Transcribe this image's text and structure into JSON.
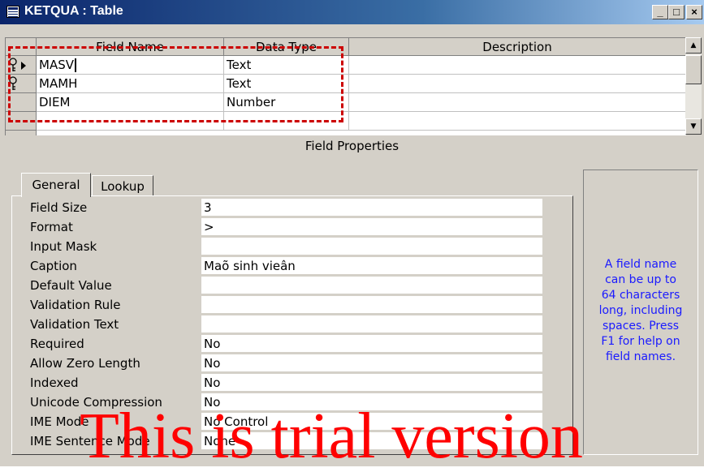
{
  "window": {
    "title": "KETQUA : Table",
    "buttons": {
      "minimize": "_",
      "maximize": "□",
      "close": "×"
    }
  },
  "grid": {
    "headers": [
      "Field Name",
      "Data Type",
      "Description"
    ],
    "rows": [
      {
        "field_name": "MASV",
        "data_type": "Text",
        "description": "",
        "key": true,
        "current": true
      },
      {
        "field_name": "MAMH",
        "data_type": "Text",
        "description": "",
        "key": true,
        "current": false
      },
      {
        "field_name": "DIEM",
        "data_type": "Number",
        "description": "",
        "key": false,
        "current": false
      },
      {
        "field_name": "",
        "data_type": "",
        "description": "",
        "key": false,
        "current": false
      }
    ]
  },
  "field_properties": {
    "title": "Field Properties",
    "tabs": [
      "General",
      "Lookup"
    ],
    "active_tab": "General",
    "properties": [
      {
        "label": "Field Size",
        "value": "3"
      },
      {
        "label": "Format",
        "value": ">"
      },
      {
        "label": "Input Mask",
        "value": ""
      },
      {
        "label": "Caption",
        "value": "Maõ sinh vieân"
      },
      {
        "label": "Default Value",
        "value": ""
      },
      {
        "label": "Validation Rule",
        "value": ""
      },
      {
        "label": "Validation Text",
        "value": ""
      },
      {
        "label": "Required",
        "value": "No"
      },
      {
        "label": "Allow Zero Length",
        "value": "No"
      },
      {
        "label": "Indexed",
        "value": "No"
      },
      {
        "label": "Unicode Compression",
        "value": "No"
      },
      {
        "label": "IME Mode",
        "value": "No Control"
      },
      {
        "label": "IME Sentence Mode",
        "value": "None"
      }
    ],
    "help_lines": [
      "A field name",
      "can be up to",
      "64 characters",
      "long, including",
      "spaces.  Press",
      "F1 for help on",
      "field names."
    ]
  },
  "watermark": "This is trial version",
  "colors": {
    "title_bar_start": "#0a246a",
    "help_text": "#1a1aff",
    "highlight_dash": "#cc0000",
    "watermark": "#ff0000",
    "window_face": "#d4d0c8"
  }
}
